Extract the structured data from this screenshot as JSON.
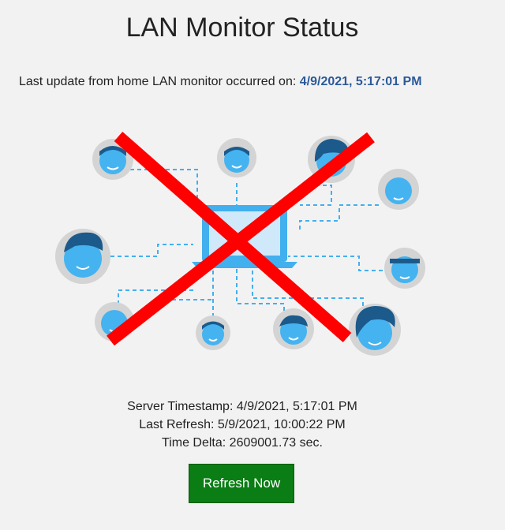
{
  "page": {
    "title": "LAN Monitor Status"
  },
  "last_update": {
    "prefix": "Last update from home LAN monitor occurred on:",
    "timestamp": "4/9/2021, 5:17:01 PM"
  },
  "stats": {
    "server_timestamp": "Server Timestamp: 4/9/2021, 5:17:01 PM",
    "last_refresh": "Last Refresh: 5/9/2021, 10:00:22 PM",
    "time_delta": "Time Delta: 2609001.73 sec."
  },
  "actions": {
    "refresh_label": "Refresh Now"
  },
  "colors": {
    "background": "#f3f2f3",
    "accent_blue": "#2a5a9a",
    "button_green": "#0a7d14",
    "cross_red": "#ff0000",
    "network_blue": "#42b0ee"
  },
  "illustration": {
    "icon": "network-offline-icon"
  }
}
